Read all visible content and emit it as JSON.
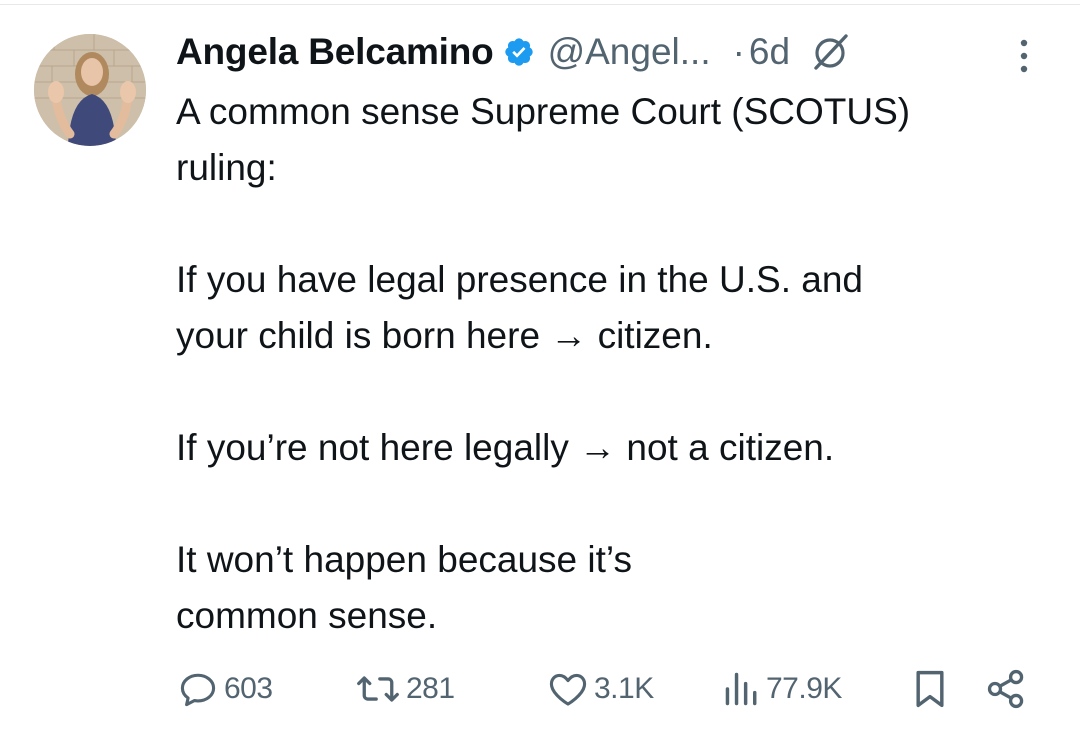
{
  "tweet": {
    "author": {
      "display_name": "Angela Belcamino",
      "handle": "@Angel...",
      "verified": true
    },
    "separator": "·",
    "time": "6d",
    "text": "A common sense Supreme Court (SCOTUS)\nruling:\n\nIf you have legal presence in the U.S. and\nyour child is born here → citizen.\n\nIf you’re not here legally → not a citizen.\n\nIt won’t happen because it’s\ncommon sense.",
    "stats": {
      "replies": "603",
      "reposts": "281",
      "likes": "3.1K",
      "views": "77.9K"
    }
  },
  "icons": {
    "verified": "verified-badge-icon",
    "grok": "grok-icon",
    "more": "more-options-icon",
    "reply": "reply-icon",
    "repost": "repost-icon",
    "like": "heart-icon",
    "views": "views-chart-icon",
    "bookmark": "bookmark-icon",
    "share": "share-icon"
  },
  "colors": {
    "text_primary": "#0f1419",
    "text_secondary": "#536471",
    "verified_blue": "#1d9bf0",
    "background": "#ffffff"
  }
}
